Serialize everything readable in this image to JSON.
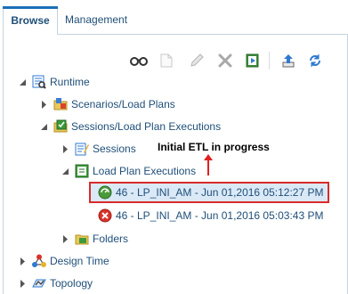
{
  "tabs": {
    "browse": "Browse",
    "management": "Management"
  },
  "toolbar": {
    "icons": [
      "view-icon",
      "new-icon",
      "edit-icon",
      "delete-icon",
      "run-icon",
      "import-icon",
      "refresh-icon"
    ]
  },
  "tree": {
    "runtime": "Runtime",
    "scenarios": "Scenarios/Load Plans",
    "sessions_lp": "Sessions/Load Plan Executions",
    "sessions": "Sessions",
    "lp_executions": "Load Plan Executions",
    "exec1": "46 - LP_INI_AM - Jun 01,2016 05:12:27 PM",
    "exec2": "46 - LP_INI_AM - Jun 01,2016 05:03:43 PM",
    "folders": "Folders",
    "design_time": "Design Time",
    "topology": "Topology"
  },
  "annotation": {
    "text": "Initial ETL in progress"
  },
  "colors": {
    "link": "#1f4f78",
    "highlight_border": "#d92b2b",
    "selection_bg": "#dbe9f7",
    "tab_accent": "#1a70b8"
  }
}
